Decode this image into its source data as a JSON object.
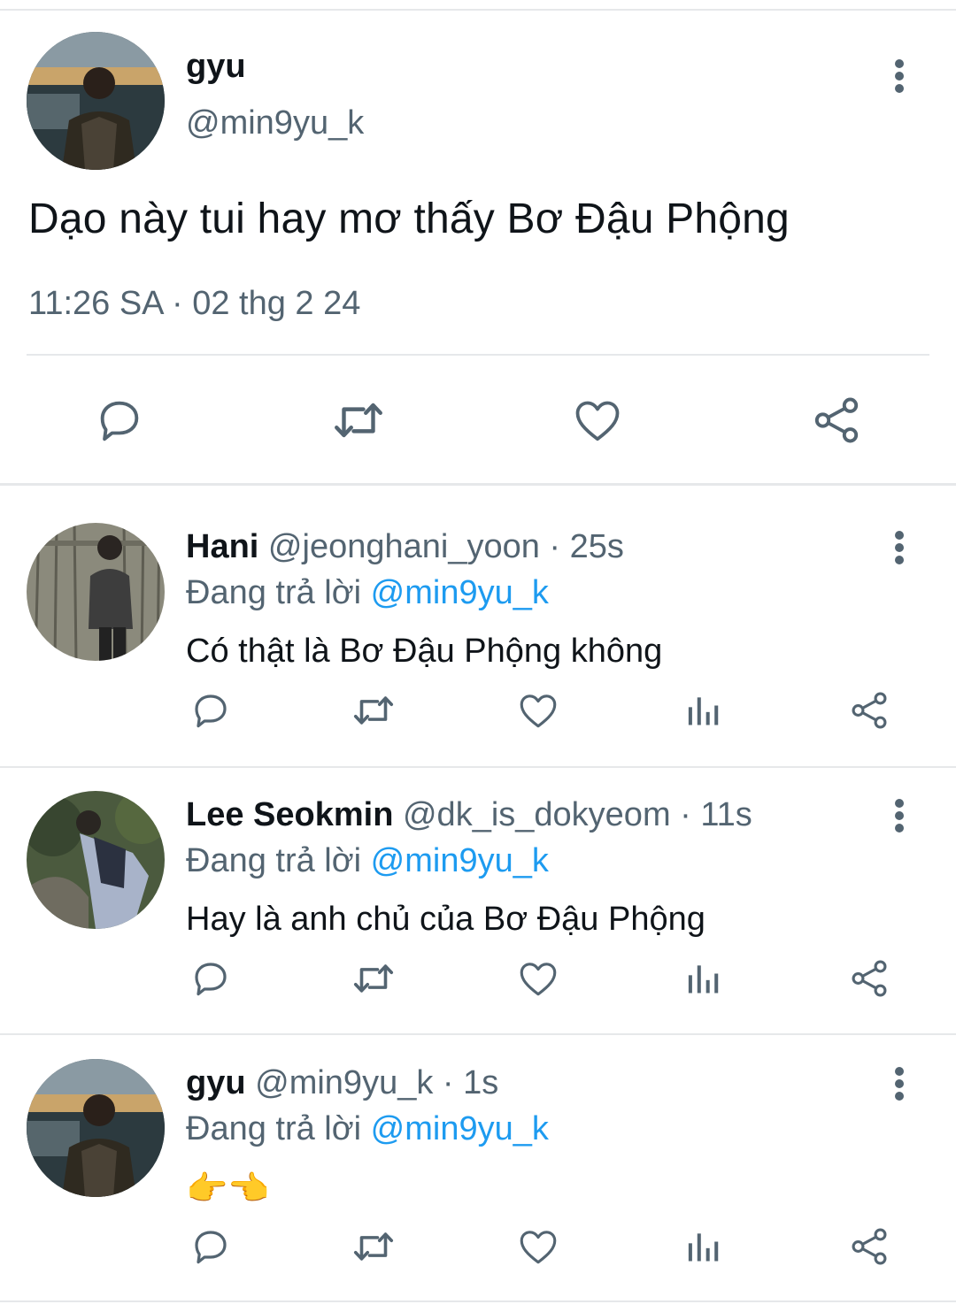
{
  "main_tweet": {
    "display_name": "gyu",
    "handle": "@min9yu_k",
    "text": "Dạo này tui hay mơ thấy Bơ Đậu Phộng",
    "timestamp": "11:26 SA · 02 thg 2 24",
    "actions": [
      "reply-icon",
      "retweet-icon",
      "like-icon",
      "share-icon"
    ]
  },
  "replies": [
    {
      "display_name": "Hani",
      "handle": "@jeonghani_yoon",
      "time": " · 25s",
      "replying_label": "Đang trả lời ",
      "replying_to": "@min9yu_k",
      "text": "Có thật là Bơ Đậu Phộng không"
    },
    {
      "display_name": "Lee Seokmin",
      "handle": "@dk_is_dokyeom",
      "time": " · 11s",
      "replying_label": "Đang trả lời ",
      "replying_to": "@min9yu_k",
      "text": "Hay là anh chủ của Bơ Đậu Phộng"
    },
    {
      "display_name": "gyu",
      "handle": "@min9yu_k",
      "time": " · 1s",
      "replying_label": "Đang trả lời ",
      "replying_to": "@min9yu_k",
      "text": "👉👈"
    }
  ],
  "colors": {
    "text": "#0f1419",
    "secondary": "#536471",
    "link": "#1d9bf0",
    "divider": "#e6e8ea"
  }
}
